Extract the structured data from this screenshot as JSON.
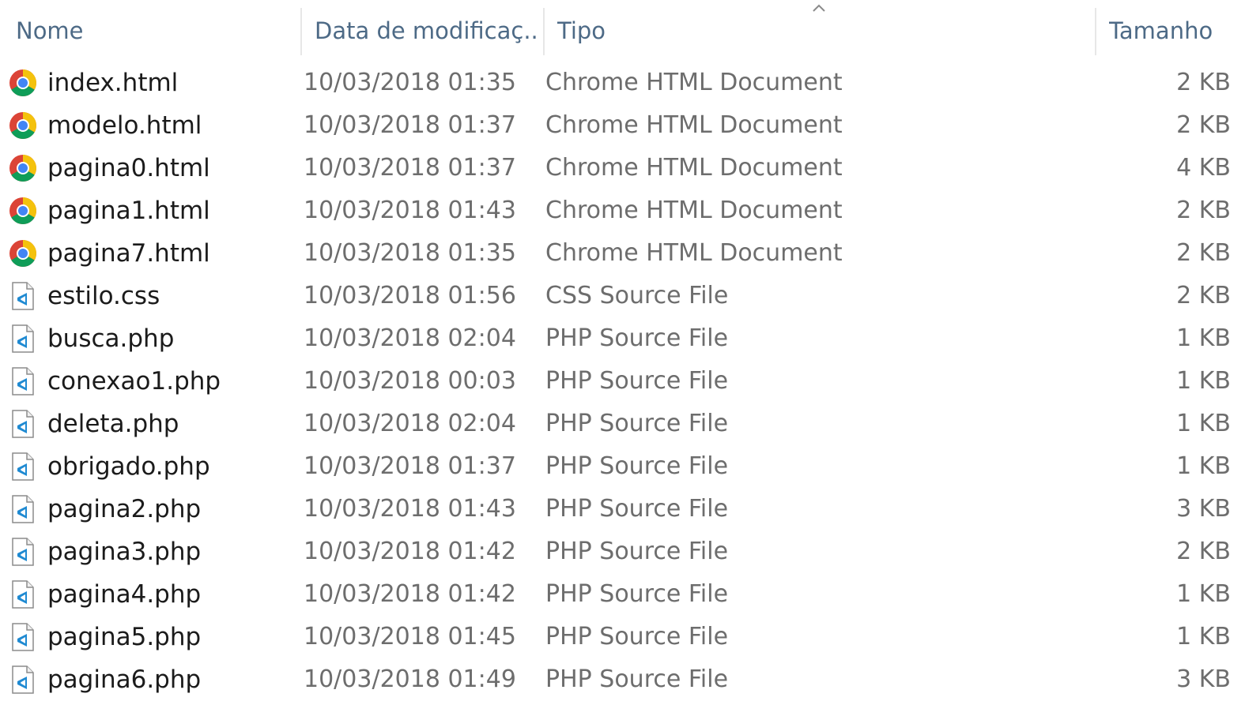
{
  "columns": {
    "name": "Nome",
    "date": "Data de modificaç...",
    "type": "Tipo",
    "size": "Tamanho"
  },
  "sort": {
    "column": "type",
    "direction": "ascending"
  },
  "colors": {
    "header_text": "#4d6a86",
    "name_text": "#1b1b1b",
    "detail_text": "#6d6d6d",
    "vscode_blue": "#1f8ad2",
    "chrome_red": "#db4437",
    "chrome_yellow": "#f4c20d",
    "chrome_green": "#0f9d58",
    "chrome_blue": "#4285f4"
  },
  "files": [
    {
      "name": "index.html",
      "date": "10/03/2018 01:35",
      "type": "Chrome HTML Document",
      "size": "2 KB",
      "icon": "chrome-icon"
    },
    {
      "name": "modelo.html",
      "date": "10/03/2018 01:37",
      "type": "Chrome HTML Document",
      "size": "2 KB",
      "icon": "chrome-icon"
    },
    {
      "name": "pagina0.html",
      "date": "10/03/2018 01:37",
      "type": "Chrome HTML Document",
      "size": "4 KB",
      "icon": "chrome-icon"
    },
    {
      "name": "pagina1.html",
      "date": "10/03/2018 01:43",
      "type": "Chrome HTML Document",
      "size": "2 KB",
      "icon": "chrome-icon"
    },
    {
      "name": "pagina7.html",
      "date": "10/03/2018 01:35",
      "type": "Chrome HTML Document",
      "size": "2 KB",
      "icon": "chrome-icon"
    },
    {
      "name": "estilo.css",
      "date": "10/03/2018 01:56",
      "type": "CSS Source File",
      "size": "2 KB",
      "icon": "vscode-file-icon"
    },
    {
      "name": "busca.php",
      "date": "10/03/2018 02:04",
      "type": "PHP Source File",
      "size": "1 KB",
      "icon": "vscode-file-icon"
    },
    {
      "name": "conexao1.php",
      "date": "10/03/2018 00:03",
      "type": "PHP Source File",
      "size": "1 KB",
      "icon": "vscode-file-icon"
    },
    {
      "name": "deleta.php",
      "date": "10/03/2018 02:04",
      "type": "PHP Source File",
      "size": "1 KB",
      "icon": "vscode-file-icon"
    },
    {
      "name": "obrigado.php",
      "date": "10/03/2018 01:37",
      "type": "PHP Source File",
      "size": "1 KB",
      "icon": "vscode-file-icon"
    },
    {
      "name": "pagina2.php",
      "date": "10/03/2018 01:43",
      "type": "PHP Source File",
      "size": "3 KB",
      "icon": "vscode-file-icon"
    },
    {
      "name": "pagina3.php",
      "date": "10/03/2018 01:42",
      "type": "PHP Source File",
      "size": "2 KB",
      "icon": "vscode-file-icon"
    },
    {
      "name": "pagina4.php",
      "date": "10/03/2018 01:42",
      "type": "PHP Source File",
      "size": "1 KB",
      "icon": "vscode-file-icon"
    },
    {
      "name": "pagina5.php",
      "date": "10/03/2018 01:45",
      "type": "PHP Source File",
      "size": "1 KB",
      "icon": "vscode-file-icon"
    },
    {
      "name": "pagina6.php",
      "date": "10/03/2018 01:49",
      "type": "PHP Source File",
      "size": "3 KB",
      "icon": "vscode-file-icon"
    }
  ]
}
